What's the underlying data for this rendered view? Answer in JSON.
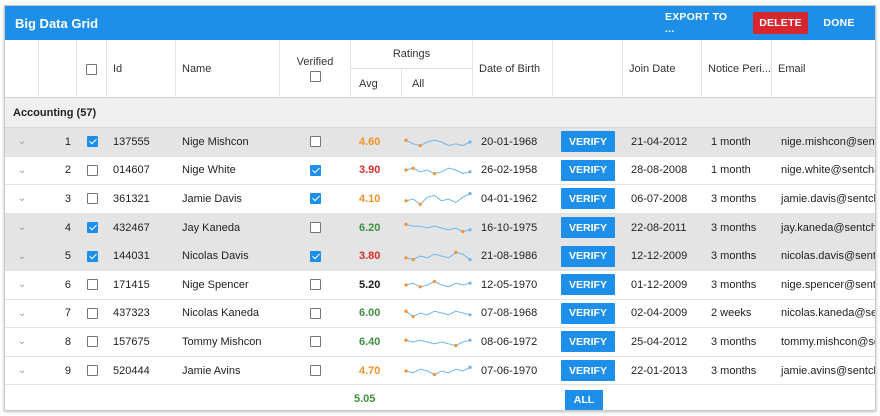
{
  "window": {
    "title": "Big Data Grid"
  },
  "toolbar": {
    "export_label": "EXPORT TO ...",
    "delete_label": "DELETE",
    "done_label": "DONE"
  },
  "columns": {
    "id": "Id",
    "name": "Name",
    "verified": "Verified",
    "ratings": "Ratings",
    "avg": "Avg",
    "all": "All",
    "dob": "Date of Birth",
    "join": "Join Date",
    "notice": "Notice Peri...",
    "email": "Email"
  },
  "group": {
    "label": "Accounting (57)"
  },
  "colors": {
    "accent": "#1e8fe8",
    "delete": "#d7262e",
    "orange": "#f0932b",
    "red": "#d32f2f",
    "green": "#3f8f3f",
    "dark": "#222222"
  },
  "rows": [
    {
      "num": "1",
      "selected": true,
      "id": "137555",
      "name": "Nige Mishcon",
      "verified": false,
      "avg": "4.60",
      "avg_color": "#f0932b",
      "spark": [
        6,
        4,
        3,
        5,
        6,
        5,
        3,
        4,
        3,
        5
      ],
      "dob": "20-01-1968",
      "verify": "VERIFY",
      "join": "21-04-2012",
      "notice": "1 month",
      "email": "nige.mishcon@sentcha.com"
    },
    {
      "num": "2",
      "selected": false,
      "id": "014607",
      "name": "Nige White",
      "verified": true,
      "avg": "3.90",
      "avg_color": "#d32f2f",
      "spark": [
        5,
        6,
        4,
        5,
        3,
        4,
        6,
        5,
        3,
        4
      ],
      "dob": "26-02-1958",
      "verify": "VERIFY",
      "join": "28-08-2008",
      "notice": "1 month",
      "email": "nige.white@sentcha.com"
    },
    {
      "num": "3",
      "selected": false,
      "id": "361321",
      "name": "Jamie Davis",
      "verified": true,
      "avg": "4.10",
      "avg_color": "#f0932b",
      "spark": [
        4,
        5,
        2,
        6,
        7,
        4,
        5,
        3,
        6,
        8
      ],
      "dob": "04-01-1962",
      "verify": "VERIFY",
      "join": "06-07-2008",
      "notice": "3 months",
      "email": "jamie.davis@sentcha.com"
    },
    {
      "num": "4",
      "selected": true,
      "id": "432467",
      "name": "Jay Kaneda",
      "verified": false,
      "avg": "6.20",
      "avg_color": "#3f8f3f",
      "spark": [
        7,
        6,
        6,
        5,
        6,
        5,
        4,
        5,
        3,
        4
      ],
      "dob": "16-10-1975",
      "verify": "VERIFY",
      "join": "22-08-2011",
      "notice": "3 months",
      "email": "jay.kaneda@sentcha.com"
    },
    {
      "num": "5",
      "selected": true,
      "id": "144031",
      "name": "Nicolas Davis",
      "verified": true,
      "avg": "3.80",
      "avg_color": "#d32f2f",
      "spark": [
        4,
        3,
        5,
        4,
        6,
        5,
        4,
        7,
        6,
        3
      ],
      "dob": "21-08-1986",
      "verify": "VERIFY",
      "join": "12-12-2009",
      "notice": "3 months",
      "email": "nicolas.davis@sentcha.com"
    },
    {
      "num": "6",
      "selected": false,
      "id": "171415",
      "name": "Nige Spencer",
      "verified": false,
      "avg": "5.20",
      "avg_color": "#222222",
      "spark": [
        5,
        6,
        4,
        5,
        7,
        5,
        4,
        6,
        5,
        6
      ],
      "dob": "12-05-1970",
      "verify": "VERIFY",
      "join": "01-12-2009",
      "notice": "3 months",
      "email": "nige.spencer@sentcha.com"
    },
    {
      "num": "7",
      "selected": false,
      "id": "437323",
      "name": "Nicolas Kaneda",
      "verified": false,
      "avg": "6.00",
      "avg_color": "#3f8f3f",
      "spark": [
        6,
        3,
        5,
        4,
        6,
        5,
        4,
        6,
        5,
        4
      ],
      "dob": "07-08-1968",
      "verify": "VERIFY",
      "join": "02-04-2009",
      "notice": "2 weeks",
      "email": "nicolas.kaneda@sentcha.com"
    },
    {
      "num": "8",
      "selected": false,
      "id": "157675",
      "name": "Tommy Mishcon",
      "verified": false,
      "avg": "6.40",
      "avg_color": "#3f8f3f",
      "spark": [
        6,
        5,
        6,
        5,
        4,
        5,
        4,
        3,
        5,
        6
      ],
      "dob": "08-06-1972",
      "verify": "VERIFY",
      "join": "25-04-2012",
      "notice": "3 months",
      "email": "tommy.mishcon@sentcha.com"
    },
    {
      "num": "9",
      "selected": false,
      "id": "520444",
      "name": "Jamie Avins",
      "verified": false,
      "avg": "4.70",
      "avg_color": "#f0932b",
      "spark": [
        5,
        4,
        6,
        5,
        3,
        5,
        4,
        6,
        5,
        7
      ],
      "dob": "07-06-1970",
      "verify": "VERIFY",
      "join": "22-01-2013",
      "notice": "3 months",
      "email": "jamie.avins@sentcha.com"
    }
  ],
  "footer": {
    "avg": "5.05",
    "all_label": "ALL"
  }
}
